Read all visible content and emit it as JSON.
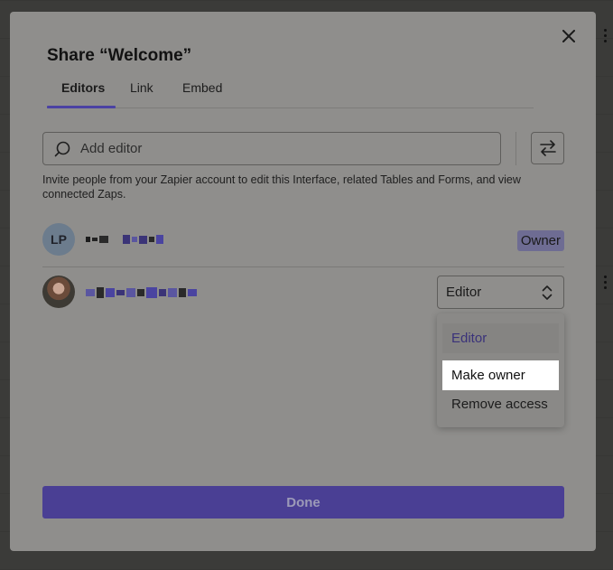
{
  "dialog": {
    "title": "Share “Welcome”",
    "close_icon": "close-icon"
  },
  "tabs": [
    {
      "label": "Editors",
      "active": true
    },
    {
      "label": "Link",
      "active": false
    },
    {
      "label": "Embed",
      "active": false
    }
  ],
  "search": {
    "placeholder": "Add editor",
    "icon": "search-icon"
  },
  "swap_icon": "swap-arrows-icon",
  "helper_text": "Invite people from your Zapier account to edit this Interface, related Tables and Forms, and view connected Zaps.",
  "members": [
    {
      "avatar_initials": "LP",
      "name_redacted": true,
      "role_badge": "Owner"
    },
    {
      "avatar_photo": true,
      "name_redacted": true,
      "role_select": "Editor"
    }
  ],
  "role_dropdown": {
    "options": [
      {
        "label": "Editor",
        "state": "selected"
      },
      {
        "label": "Make owner",
        "state": "hover"
      },
      {
        "label": "Remove access",
        "state": "normal"
      }
    ]
  },
  "done_label": "Done",
  "colors": {
    "accent": "#4b42a3",
    "done_button": "#4a3f94",
    "modal_bg_dimmed": "#8f8e8c"
  }
}
